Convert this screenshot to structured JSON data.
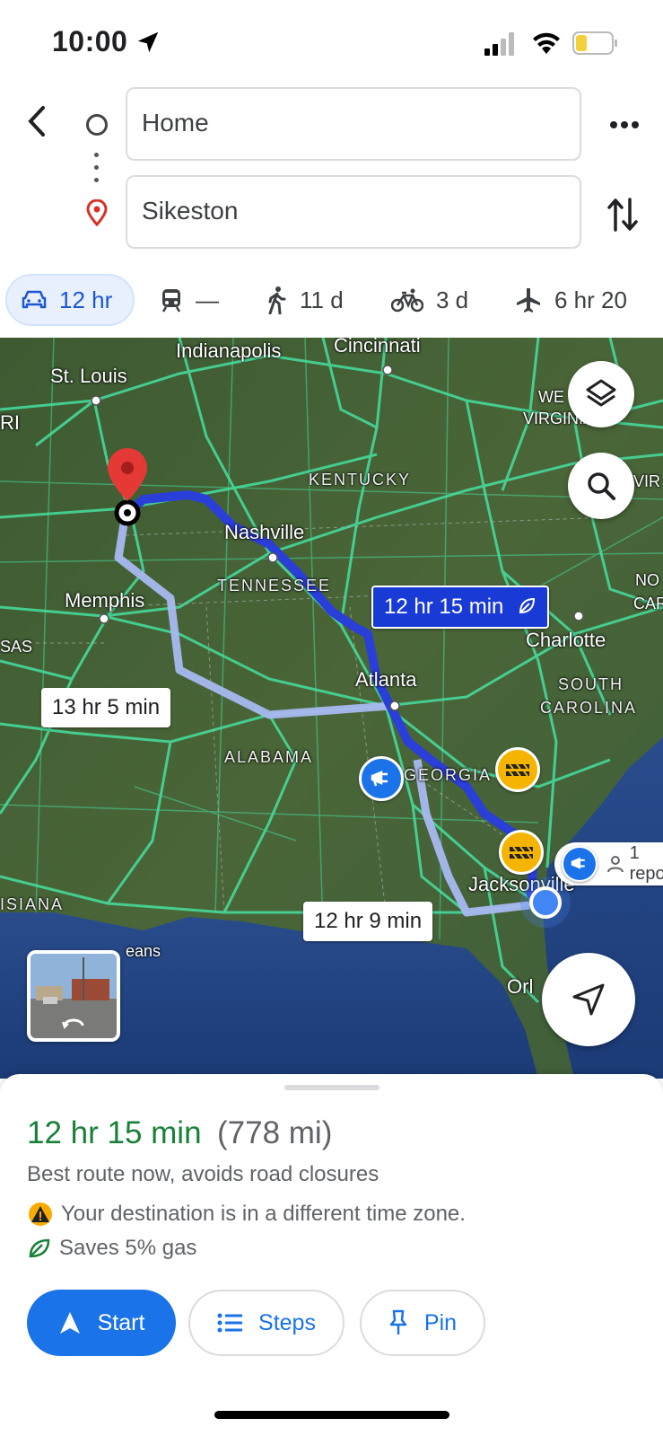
{
  "status": {
    "time": "10:00"
  },
  "search": {
    "origin": "Home",
    "destination": "Sikeston"
  },
  "modes": [
    {
      "name": "drive",
      "label": "12 hr"
    },
    {
      "name": "transit",
      "label": "—"
    },
    {
      "name": "walk",
      "label": "11 d"
    },
    {
      "name": "bike",
      "label": "3 d"
    },
    {
      "name": "flight",
      "label": "6 hr 20"
    }
  ],
  "map": {
    "cities": [
      "St. Louis",
      "Indianapolis",
      "Cincinnati",
      "Nashville",
      "Memphis",
      "Atlanta",
      "Charlotte",
      "Jacksonville",
      "Orl",
      "eans",
      "RI",
      "SAS",
      "ISIANA",
      "WE",
      "VIRGINIA",
      "VIR",
      "NO",
      "CAR"
    ],
    "states": [
      "KENTUCKY",
      "TENNESSEE",
      "ALABAMA",
      "GEORGIA",
      "SOUTH",
      "CAROLINA"
    ],
    "routes": {
      "primary": "12 hr 15 min",
      "alt1": "13 hr 5 min",
      "alt2": "12 hr 9 min"
    },
    "report_text": "1 repo"
  },
  "summary": {
    "eta": "12 hr 15 min",
    "distance": "(778 mi)",
    "description": "Best route now, avoids road closures",
    "timezone_warning": "Your destination is in a different time zone.",
    "gas_savings": "Saves 5% gas"
  },
  "actions": {
    "start": "Start",
    "steps": "Steps",
    "pin": "Pin"
  }
}
